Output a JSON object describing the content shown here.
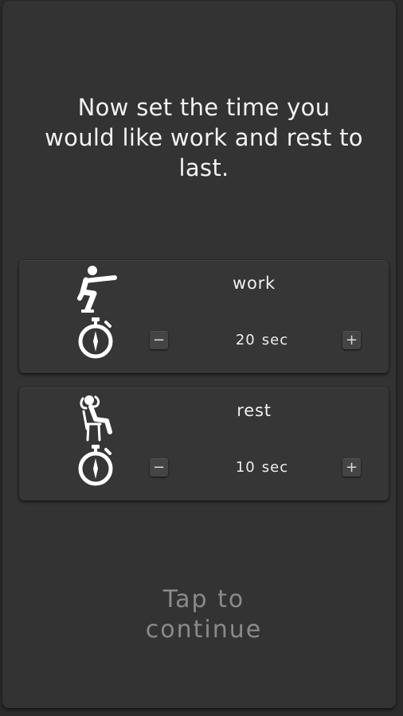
{
  "instructions": {
    "line1": "Now set the time you",
    "line2": "would like work and rest to",
    "line3": "last."
  },
  "intervals": [
    {
      "label": "work",
      "value": "20",
      "unit": "sec",
      "pose_icon": "squat-figure-icon",
      "timer_icon": "stopwatch-icon",
      "decrement_label": "−",
      "increment_label": "+"
    },
    {
      "label": "rest",
      "value": "10",
      "unit": "sec",
      "pose_icon": "seated-relaxing-figure-icon",
      "timer_icon": "stopwatch-icon",
      "decrement_label": "−",
      "increment_label": "+"
    }
  ],
  "continue": {
    "line1": "Tap to",
    "line2": "continue"
  },
  "colors": {
    "background": "#2b2b2b",
    "panel": "#333333",
    "card": "#363636",
    "text": "#f2f2f2",
    "muted_text": "#8a8a8a"
  }
}
